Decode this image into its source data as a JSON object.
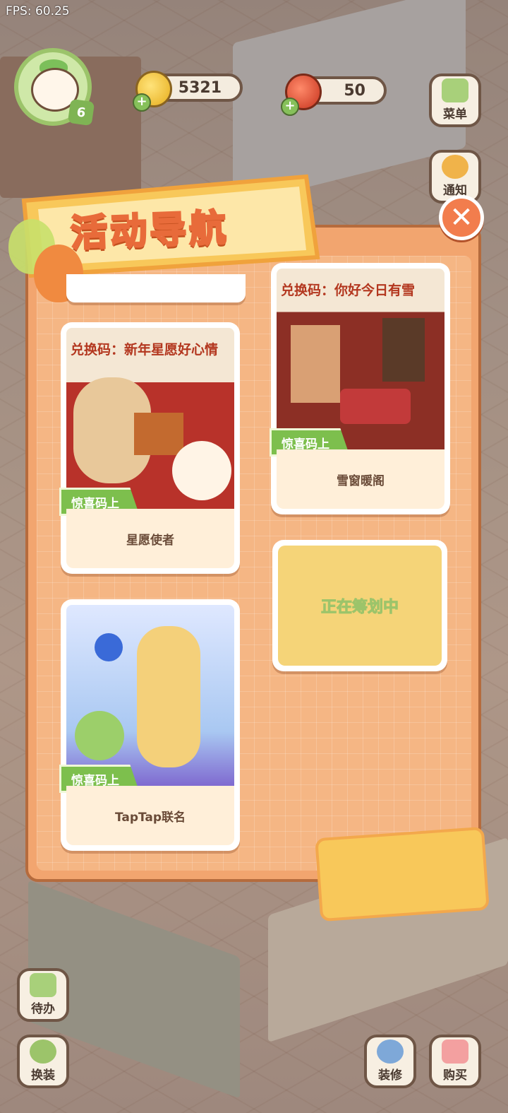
{
  "fps": "FPS: 60.25",
  "hud": {
    "level": "6",
    "coins": "5321",
    "cherries": "50"
  },
  "side_buttons": {
    "menu": "菜单",
    "notice": "通知",
    "todo": "待办",
    "dress": "换装",
    "decorate": "装修",
    "shop": "购买"
  },
  "panel": {
    "title": "活动导航",
    "close_symbol": "✕",
    "cards": [
      {
        "name": "星愿使者",
        "tag": "惊喜码上",
        "art_title": "兑换码：新年星愿好心情"
      },
      {
        "name": "雪窗暖阁",
        "tag": "惊喜码上",
        "art_title": "兑换码：你好今日有雪"
      },
      {
        "name": "TapTap联名",
        "tag": "惊喜码上",
        "art_title": ""
      }
    ],
    "placeholder": "正在筹划中"
  },
  "colors": {
    "panel": "#f2a56f",
    "tag": "#7dbf4d",
    "title_stroke": "#e86b3a"
  }
}
